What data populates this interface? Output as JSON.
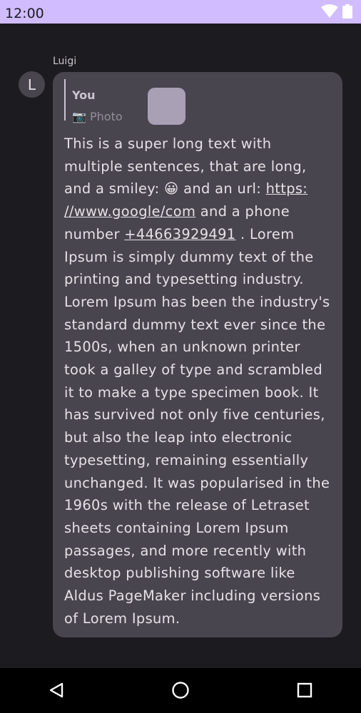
{
  "status_bar": {
    "time": "12:00",
    "icons": [
      "wifi-icon",
      "battery-icon"
    ],
    "background": "#d0bcff"
  },
  "chat": {
    "background": "#1c1b1f",
    "message": {
      "sender_name": "Luigi",
      "avatar_initial": "L",
      "reply": {
        "author": "You",
        "preview_icon": "📷",
        "preview_text": "Photo"
      },
      "text_segments": {
        "part1": "This is a super long text with multiple sentences, that are long, and a smiley: 😀 and an url: ",
        "url_part1": "https:",
        "url_part2": "//www.google/com",
        "part2": " and a phone number ",
        "phone": "+44663929491",
        "part3": " . Lorem Ipsum is simply dummy text of the printing and typesetting industry. Lorem Ipsum has been the industry's standard dummy text ever since the 1500s, when an unknown printer took a galley of type and scrambled it to make a type specimen book. It has survived not only five centuries, but also the leap into electronic typesetting, remaining essentially unchanged. It was popularised in the 1960s with the release of Letraset sheets containing Lorem Ipsum passages, and more recently with desktop publishing software like Aldus PageMaker including versions of Lorem Ipsum."
      },
      "bubble_color": "#49454f"
    }
  },
  "nav_bar": {
    "buttons": [
      "back-icon",
      "home-icon",
      "recents-icon"
    ]
  }
}
